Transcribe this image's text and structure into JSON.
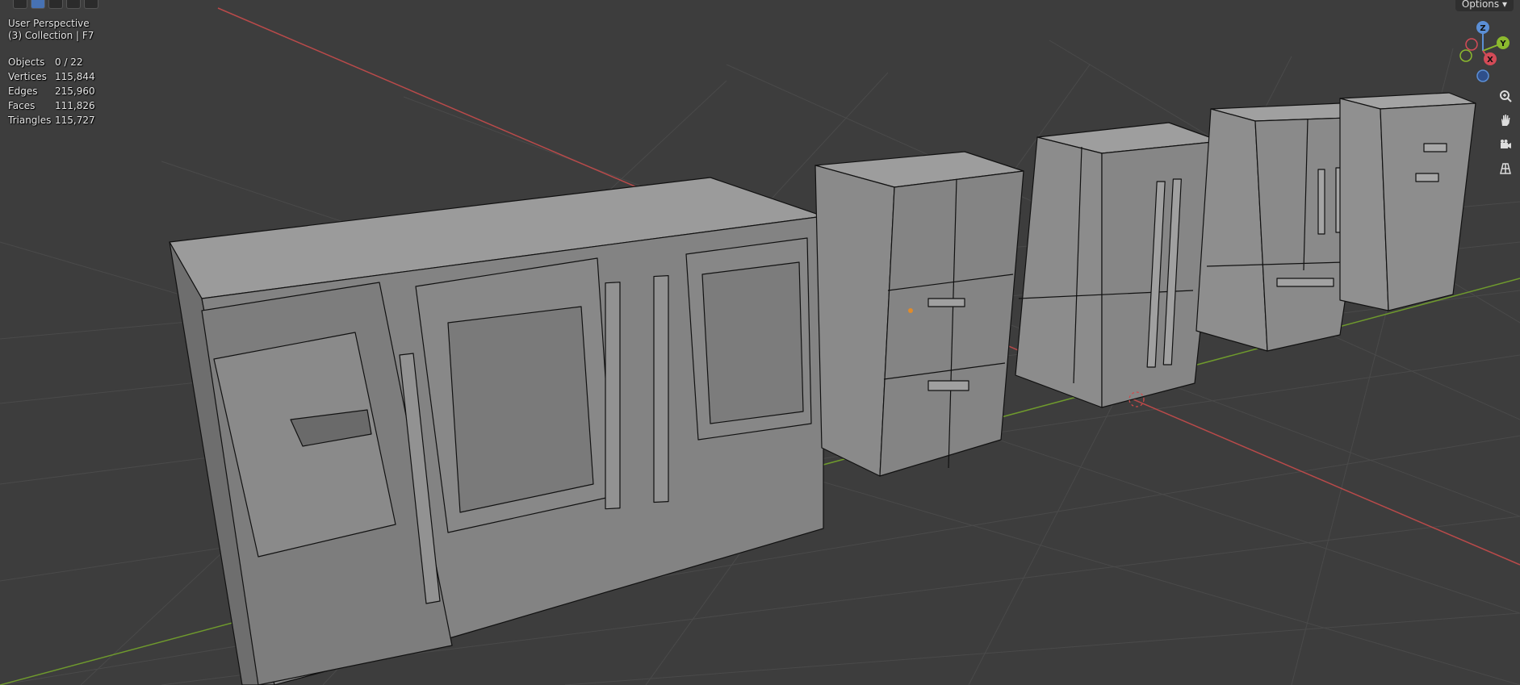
{
  "viewport": {
    "view_name": "User Perspective",
    "collection": "(3) Collection | F7",
    "stats": [
      {
        "label": "Objects",
        "value": "0 / 22"
      },
      {
        "label": "Vertices",
        "value": "115,844"
      },
      {
        "label": "Edges",
        "value": "215,960"
      },
      {
        "label": "Faces",
        "value": "111,826"
      },
      {
        "label": "Triangles",
        "value": "115,727"
      }
    ]
  },
  "header": {
    "options_label": "Options"
  },
  "gizmo": {
    "z": "Z",
    "y": "Y",
    "x": "X"
  },
  "nav_icons": [
    "zoom-icon",
    "hand-pan-icon",
    "camera-icon",
    "grid-ortho-icon"
  ],
  "colors": {
    "background": "#3d3d3d",
    "grid": "#474747",
    "x_axis": "#b94a4a",
    "y_axis": "#6f9a2d",
    "mesh_fill": "#8a8a8a",
    "wire": "#111111"
  }
}
